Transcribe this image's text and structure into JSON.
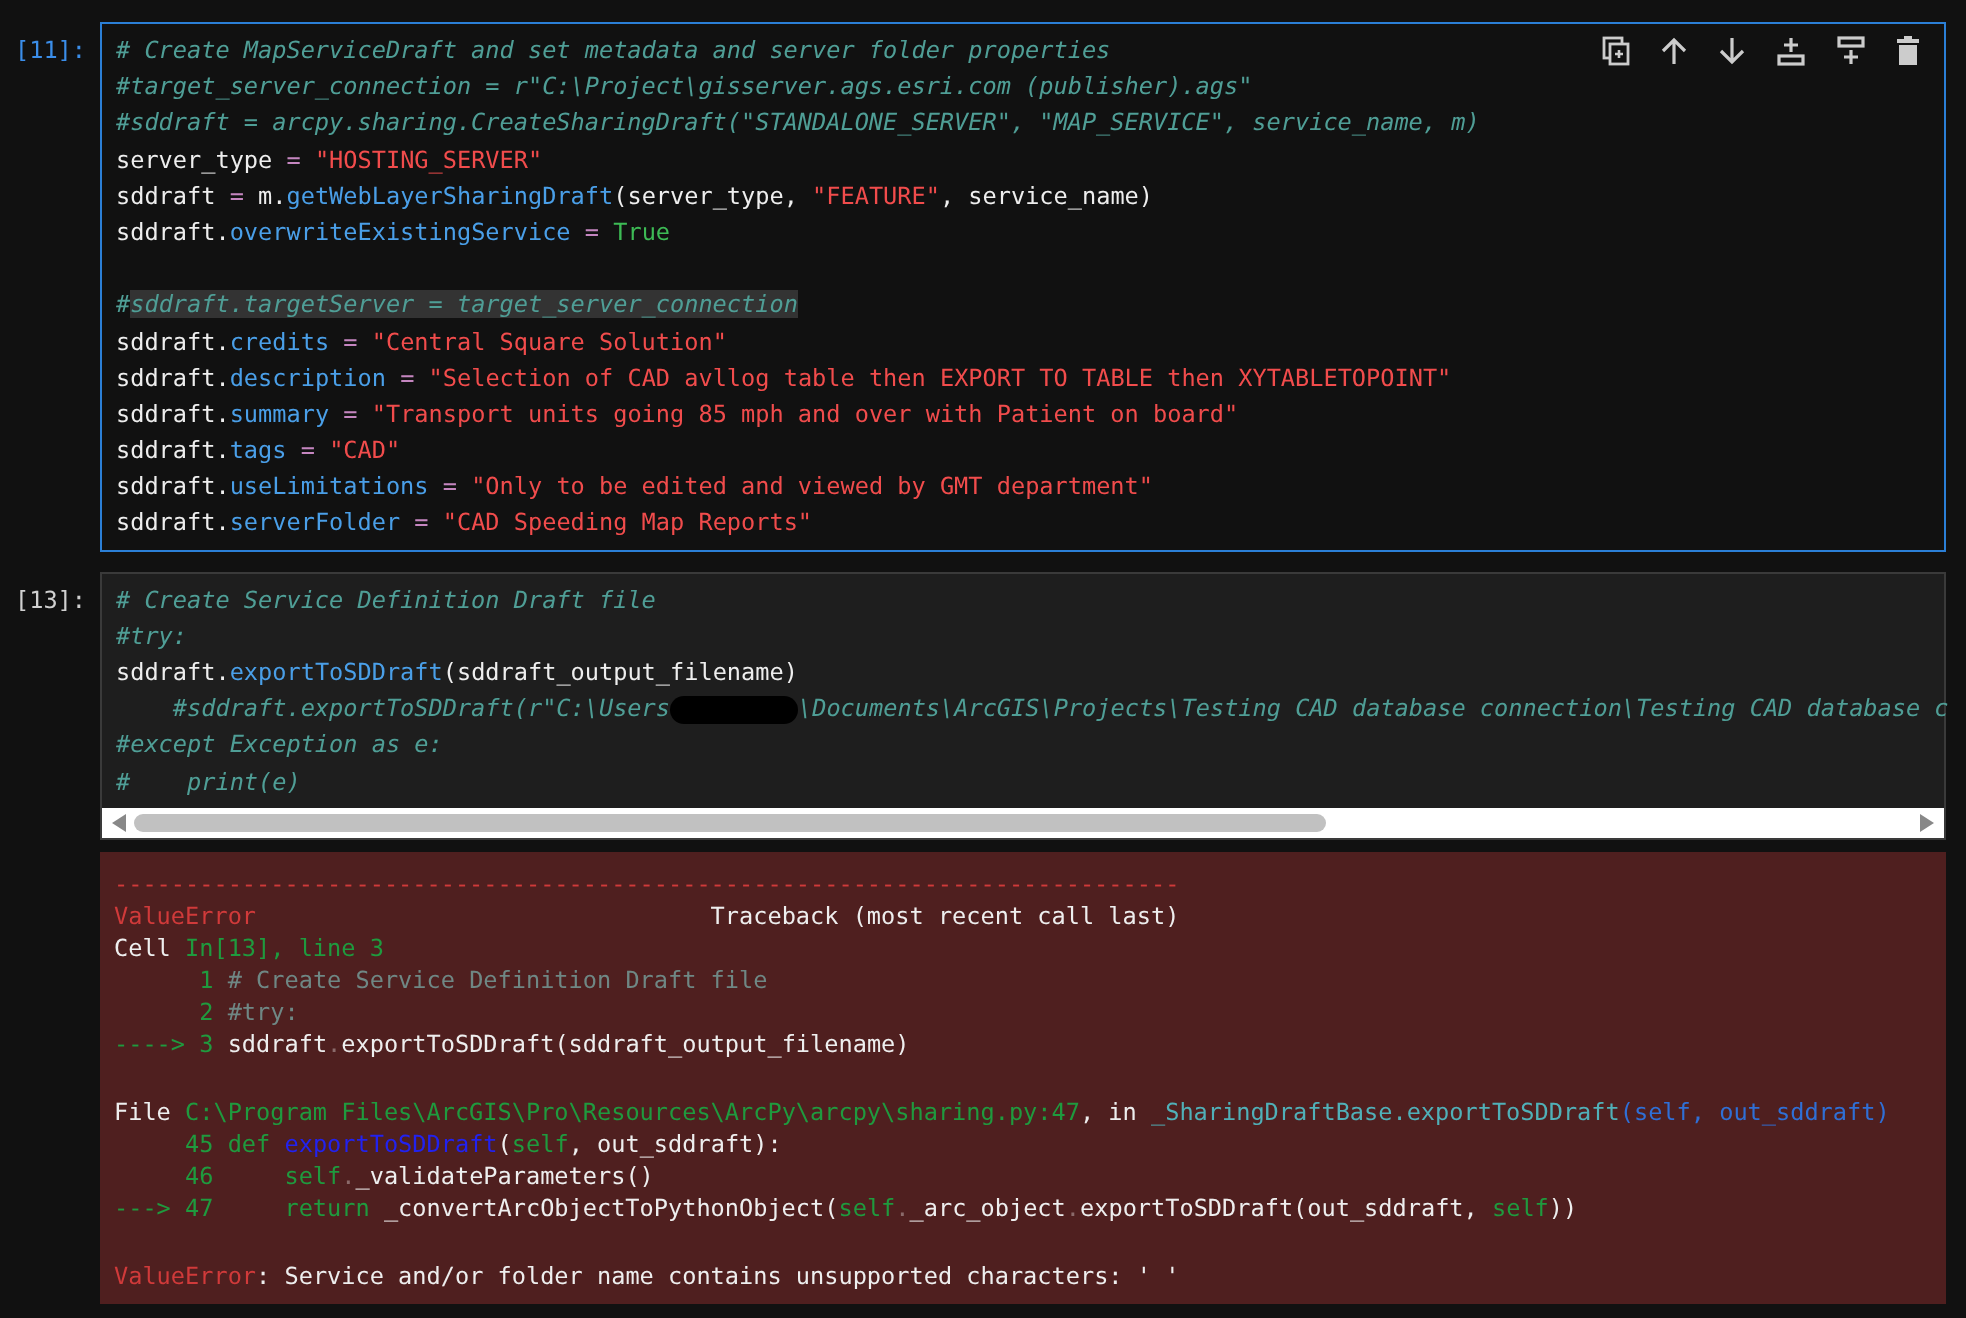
{
  "cells": [
    {
      "prompt": "[11]:",
      "selected": true,
      "horizontal_scroll": false,
      "lines": [
        {
          "tokens": [
            {
              "kind": "comment",
              "text": "# Create MapServiceDraft and set metadata and server folder properties"
            }
          ]
        },
        {
          "tokens": [
            {
              "kind": "comment",
              "text": "#target_server_connection = r\"C:\\Project\\gisserver.ags.esri.com (publisher).ags\""
            }
          ]
        },
        {
          "tokens": [
            {
              "kind": "comment",
              "text": "#sddraft = arcpy.sharing.CreateSharingDraft(\"STANDALONE_SERVER\", \"MAP_SERVICE\", service_name, m)"
            }
          ]
        },
        {
          "tokens": [
            {
              "kind": "plain",
              "text": "server_type"
            },
            {
              "kind": "op",
              "text": " = "
            },
            {
              "kind": "str",
              "text": "\"HOSTING_SERVER\""
            }
          ]
        },
        {
          "tokens": [
            {
              "kind": "plain",
              "text": "sddraft"
            },
            {
              "kind": "op",
              "text": " = "
            },
            {
              "kind": "plain",
              "text": "m."
            },
            {
              "kind": "attr",
              "text": "getWebLayerSharingDraft"
            },
            {
              "kind": "plain",
              "text": "(server_type, "
            },
            {
              "kind": "str",
              "text": "\"FEATURE\""
            },
            {
              "kind": "plain",
              "text": ", service_name)"
            }
          ]
        },
        {
          "tokens": [
            {
              "kind": "plain",
              "text": "sddraft."
            },
            {
              "kind": "attr",
              "text": "overwriteExistingService"
            },
            {
              "kind": "op",
              "text": " = "
            },
            {
              "kind": "bool",
              "text": "True"
            }
          ]
        },
        {
          "blank_before": true,
          "tokens": [
            {
              "kind": "comment",
              "text": "#"
            },
            {
              "kind": "marked",
              "text": "sddraft.targetServer = target_server_connection"
            }
          ]
        },
        {
          "tokens": [
            {
              "kind": "plain",
              "text": "sddraft."
            },
            {
              "kind": "attr",
              "text": "credits"
            },
            {
              "kind": "op",
              "text": " = "
            },
            {
              "kind": "str",
              "text": "\"Central Square Solution\""
            }
          ]
        },
        {
          "tokens": [
            {
              "kind": "plain",
              "text": "sddraft."
            },
            {
              "kind": "attr",
              "text": "description"
            },
            {
              "kind": "op",
              "text": " = "
            },
            {
              "kind": "str",
              "text": "\"Selection of CAD avllog table then EXPORT TO TABLE then XYTABLETOPOINT\""
            }
          ]
        },
        {
          "tokens": [
            {
              "kind": "plain",
              "text": "sddraft."
            },
            {
              "kind": "attr",
              "text": "summary"
            },
            {
              "kind": "op",
              "text": " = "
            },
            {
              "kind": "str",
              "text": "\"Transport units going 85 mph and over with Patient on board\""
            }
          ]
        },
        {
          "tokens": [
            {
              "kind": "plain",
              "text": "sddraft."
            },
            {
              "kind": "attr",
              "text": "tags"
            },
            {
              "kind": "op",
              "text": " = "
            },
            {
              "kind": "str",
              "text": "\"CAD\""
            }
          ]
        },
        {
          "tokens": [
            {
              "kind": "plain",
              "text": "sddraft."
            },
            {
              "kind": "attr",
              "text": "useLimitations"
            },
            {
              "kind": "op",
              "text": " = "
            },
            {
              "kind": "str",
              "text": "\"Only to be edited and viewed by GMT department\""
            }
          ]
        },
        {
          "tokens": [
            {
              "kind": "plain",
              "text": "sddraft."
            },
            {
              "kind": "attr",
              "text": "serverFolder"
            },
            {
              "kind": "op",
              "text": " = "
            },
            {
              "kind": "str",
              "text": "\"CAD Speeding Map Reports\""
            }
          ]
        }
      ]
    },
    {
      "prompt": "[13]:",
      "selected": false,
      "horizontal_scroll": true,
      "lines": [
        {
          "tokens": [
            {
              "kind": "comment",
              "text": "# Create Service Definition Draft file"
            }
          ]
        },
        {
          "tokens": [
            {
              "kind": "comment",
              "text": "#try:"
            }
          ]
        },
        {
          "tokens": [
            {
              "kind": "plain",
              "text": "sddraft."
            },
            {
              "kind": "attr",
              "text": "exportToSDDraft"
            },
            {
              "kind": "plain",
              "text": "(sddraft_output_filename)"
            }
          ]
        },
        {
          "tokens": [
            {
              "kind": "comment",
              "text": "    #sddraft.exportToSDDraft(r\"C:\\Users"
            },
            {
              "kind": "redaction"
            },
            {
              "kind": "comment",
              "text": "\\Documents\\ArcGIS\\Projects\\Testing CAD database connection\\Testing CAD database c"
            }
          ]
        },
        {
          "tokens": [
            {
              "kind": "comment",
              "text": "#except Exception as e:"
            }
          ]
        },
        {
          "tokens": [
            {
              "kind": "comment",
              "text": "#    print(e)"
            }
          ]
        }
      ]
    }
  ],
  "output": {
    "lines": [
      {
        "tokens": [
          {
            "kind": "err",
            "text": "---------------------------------------------------------------------------"
          }
        ]
      },
      {
        "tokens": [
          {
            "kind": "err",
            "text": "ValueError"
          },
          {
            "kind": "plain",
            "text": "                                Traceback (most recent call last)"
          }
        ]
      },
      {
        "tokens": [
          {
            "kind": "plain",
            "text": "Cell "
          },
          {
            "kind": "green",
            "text": "In[13], line 3"
          }
        ]
      },
      {
        "tokens": [
          {
            "kind": "green",
            "text": "      1 "
          },
          {
            "kind": "grey",
            "text": "# Create Service Definition Draft file"
          }
        ]
      },
      {
        "tokens": [
          {
            "kind": "green",
            "text": "      2 "
          },
          {
            "kind": "grey",
            "text": "#try:"
          }
        ]
      },
      {
        "tokens": [
          {
            "kind": "green",
            "text": "----> 3 "
          },
          {
            "kind": "plain",
            "text": "sddraft"
          },
          {
            "kind": "dim",
            "text": "."
          },
          {
            "kind": "plain",
            "text": "exportToSDDraft(sddraft_output_filename)"
          }
        ]
      },
      {
        "blank_before": true,
        "tokens": [
          {
            "kind": "plain",
            "text": "File "
          },
          {
            "kind": "green",
            "text": "C:\\Program Files\\ArcGIS\\Pro\\Resources\\ArcPy\\arcpy\\sharing.py:47"
          },
          {
            "kind": "plain",
            "text": ", in "
          },
          {
            "kind": "teal",
            "text": "_SharingDraftBase.exportToSDDraft"
          },
          {
            "kind": "blue",
            "text": "(self, out_sddraft)"
          }
        ]
      },
      {
        "tokens": [
          {
            "kind": "green",
            "text": "     45 def "
          },
          {
            "kind": "deepblue",
            "text": "exportToSDDraft"
          },
          {
            "kind": "plain",
            "text": "("
          },
          {
            "kind": "green",
            "text": "self"
          },
          {
            "kind": "plain",
            "text": ", out_sddraft):"
          }
        ]
      },
      {
        "tokens": [
          {
            "kind": "green",
            "text": "     46     self"
          },
          {
            "kind": "dim",
            "text": "."
          },
          {
            "kind": "plain",
            "text": "_validateParameters()"
          }
        ]
      },
      {
        "tokens": [
          {
            "kind": "green",
            "text": "---> 47     return"
          },
          {
            "kind": "plain",
            "text": " _convertArcObjectToPythonObject("
          },
          {
            "kind": "green",
            "text": "self"
          },
          {
            "kind": "dim",
            "text": "."
          },
          {
            "kind": "plain",
            "text": "_arc_object"
          },
          {
            "kind": "dim",
            "text": "."
          },
          {
            "kind": "plain",
            "text": "exportToSDDraft(out_sddraft, "
          },
          {
            "kind": "green",
            "text": "self"
          },
          {
            "kind": "plain",
            "text": "))"
          }
        ]
      },
      {
        "blank_before": true,
        "tokens": [
          {
            "kind": "err",
            "text": "ValueError"
          },
          {
            "kind": "plain",
            "text": ": Service and/or folder name contains unsupported characters: ' '"
          }
        ]
      }
    ]
  }
}
